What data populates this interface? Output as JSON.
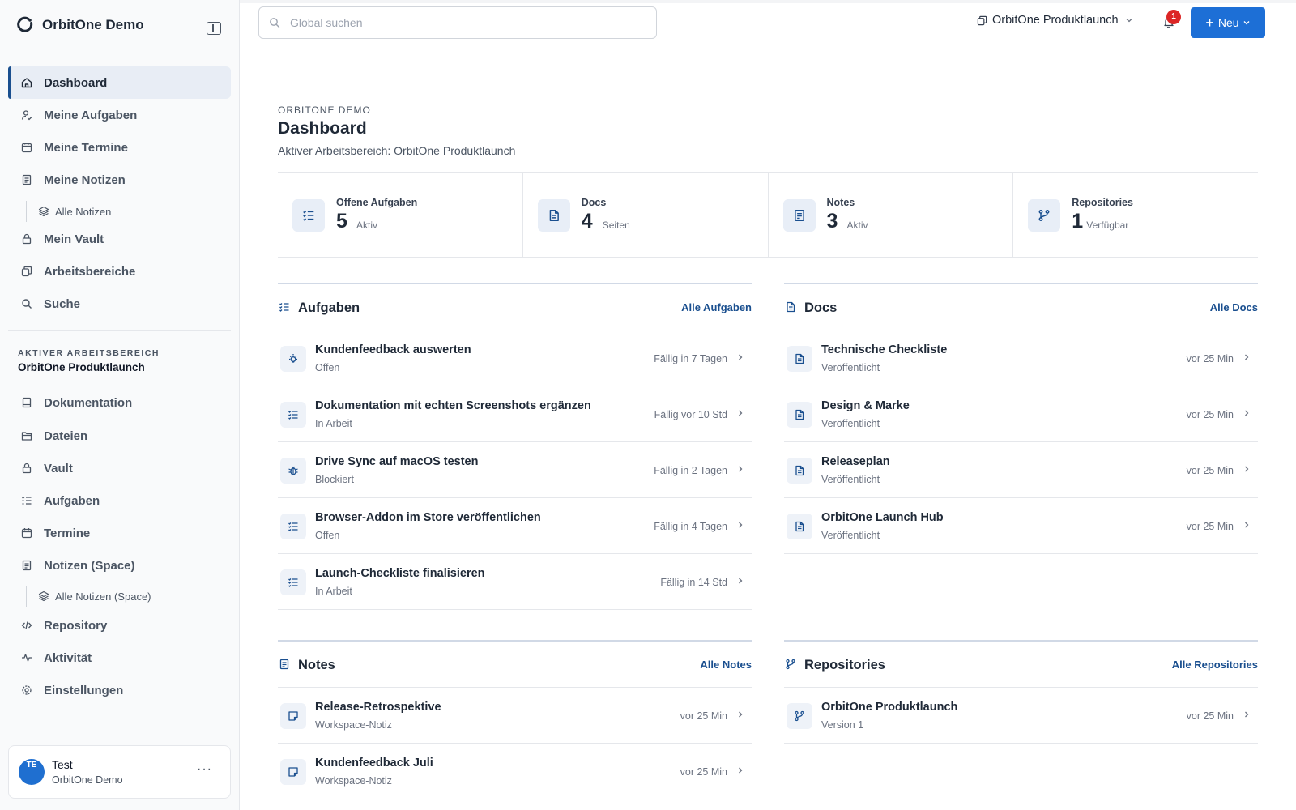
{
  "app": {
    "name": "OrbitOne Demo"
  },
  "sidebar": {
    "nav": [
      {
        "label": "Dashboard",
        "icon": "home-icon"
      },
      {
        "label": "Meine Aufgaben",
        "icon": "user-check-icon"
      },
      {
        "label": "Meine Termine",
        "icon": "calendar-icon"
      },
      {
        "label": "Meine Notizen",
        "icon": "note-icon"
      },
      {
        "label": "Alle Notizen",
        "icon": "layers-icon"
      },
      {
        "label": "Mein Vault",
        "icon": "lock-icon"
      },
      {
        "label": "Arbeitsbereiche",
        "icon": "workspaces-icon"
      },
      {
        "label": "Suche",
        "icon": "search-icon"
      }
    ],
    "workspace_caption": "AKTIVER ARBEITSBEREICH",
    "workspace_name": "OrbitOne Produktlaunch",
    "ws_nav": [
      {
        "label": "Dokumentation",
        "icon": "book-icon"
      },
      {
        "label": "Dateien",
        "icon": "folder-icon"
      },
      {
        "label": "Vault",
        "icon": "lock-icon"
      },
      {
        "label": "Aufgaben",
        "icon": "list-check-icon"
      },
      {
        "label": "Termine",
        "icon": "calendar-icon"
      },
      {
        "label": "Notizen (Space)",
        "icon": "note-icon"
      },
      {
        "label": "Alle Notizen (Space)",
        "icon": "layers-icon"
      },
      {
        "label": "Repository",
        "icon": "code-icon"
      },
      {
        "label": "Aktivität",
        "icon": "activity-icon"
      },
      {
        "label": "Einstellungen",
        "icon": "settings-icon"
      }
    ],
    "user": {
      "initials": "TE",
      "name": "Test",
      "org": "OrbitOne Demo",
      "more": "···"
    }
  },
  "topbar": {
    "search_placeholder": "Global suchen",
    "workspace": "OrbitOne Produktlaunch",
    "notifications": "1",
    "new_label": "Neu"
  },
  "page": {
    "eyebrow": "ORBITONE DEMO",
    "title": "Dashboard",
    "subtitle": "Aktiver Arbeitsbereich: OrbitOne Produktlaunch"
  },
  "stats": [
    {
      "label": "Offene Aufgaben",
      "value": "5",
      "note": "Aktiv",
      "icon": "list-check-icon"
    },
    {
      "label": "Docs",
      "value": "4",
      "note": "Seiten",
      "icon": "document-icon"
    },
    {
      "label": "Notes",
      "value": "3",
      "note": "Aktiv",
      "icon": "note-icon"
    },
    {
      "label": "Repositories",
      "value": "1",
      "note": "Verfügbar",
      "icon": "git-branch-icon"
    }
  ],
  "panels": {
    "tasks": {
      "title": "Aufgaben",
      "link": "Alle Aufgaben",
      "rows": [
        {
          "title": "Kundenfeedback auswerten",
          "sub": "Offen",
          "meta": "Fällig in 7 Tagen",
          "icon": "lightbulb-icon"
        },
        {
          "title": "Dokumentation mit echten Screenshots ergänzen",
          "sub": "In Arbeit",
          "meta": "Fällig vor 10 Std",
          "icon": "list-check-icon"
        },
        {
          "title": "Drive Sync auf macOS testen",
          "sub": "Blockiert",
          "meta": "Fällig in 2 Tagen",
          "icon": "bug-icon"
        },
        {
          "title": "Browser-Addon im Store veröffentlichen",
          "sub": "Offen",
          "meta": "Fällig in 4 Tagen",
          "icon": "list-check-icon"
        },
        {
          "title": "Launch-Checkliste finalisieren",
          "sub": "In Arbeit",
          "meta": "Fällig in 14 Std",
          "icon": "list-check-icon"
        }
      ]
    },
    "docs": {
      "title": "Docs",
      "link": "Alle Docs",
      "rows": [
        {
          "title": "Technische Checkliste",
          "sub": "Veröffentlicht",
          "meta": "vor 25 Min",
          "icon": "document-icon"
        },
        {
          "title": "Design & Marke",
          "sub": "Veröffentlicht",
          "meta": "vor 25 Min",
          "icon": "document-icon"
        },
        {
          "title": "Releaseplan",
          "sub": "Veröffentlicht",
          "meta": "vor 25 Min",
          "icon": "document-icon"
        },
        {
          "title": "OrbitOne Launch Hub",
          "sub": "Veröffentlicht",
          "meta": "vor 25 Min",
          "icon": "document-icon"
        }
      ]
    },
    "notes": {
      "title": "Notes",
      "link": "Alle Notes",
      "rows": [
        {
          "title": "Release-Retrospektive",
          "sub": "Workspace-Notiz",
          "meta": "vor 25 Min",
          "icon": "sticky-note-icon"
        },
        {
          "title": "Kundenfeedback Juli",
          "sub": "Workspace-Notiz",
          "meta": "vor 25 Min",
          "icon": "sticky-note-icon"
        }
      ]
    },
    "repos": {
      "title": "Repositories",
      "link": "Alle Repositories",
      "rows": [
        {
          "title": "OrbitOne Produktlaunch",
          "sub": "Version 1",
          "meta": "vor 25 Min",
          "icon": "git-branch-icon"
        }
      ]
    }
  },
  "colors": {
    "accent": "#1a4f8f",
    "primary_button": "#1d6fd6",
    "badge": "#dc2626"
  }
}
